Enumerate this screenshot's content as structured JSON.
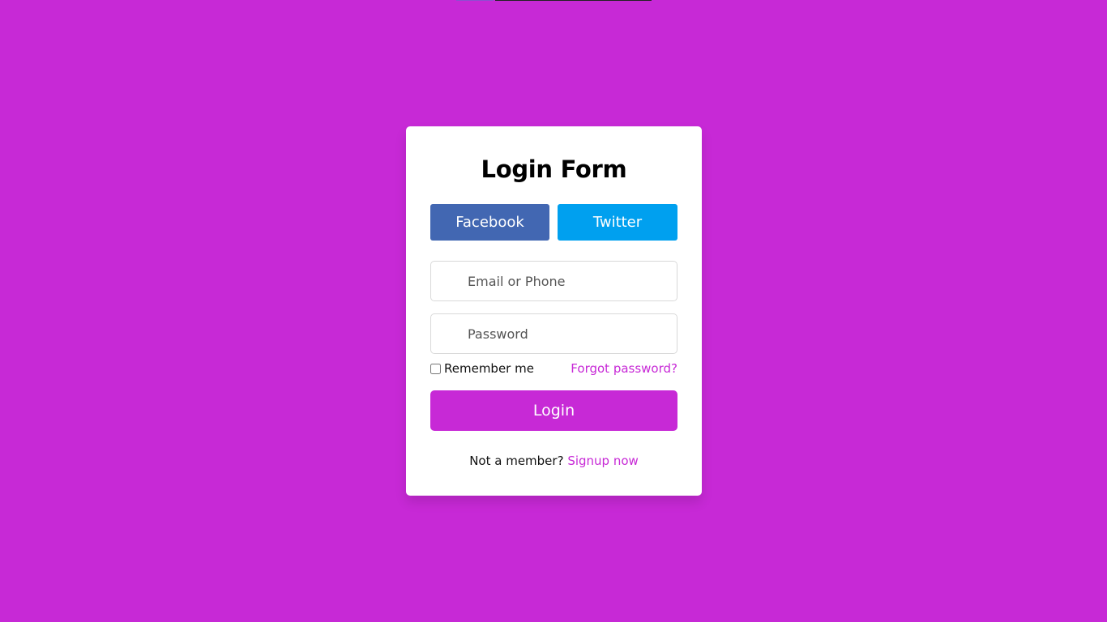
{
  "colors": {
    "background": "#c729d6",
    "accent": "#c729d6",
    "facebook": "#4267b2",
    "twitter": "#00a0ef"
  },
  "form": {
    "title": "Login Form",
    "facebook_label": "Facebook",
    "twitter_label": "Twitter",
    "email_placeholder": "Email or Phone",
    "email_value": "",
    "password_placeholder": "Password",
    "password_value": "",
    "remember_label": "Remember me",
    "remember_checked": false,
    "forgot_label": "Forgot password?",
    "login_label": "Login",
    "signup_prompt": "Not a member?",
    "signup_link": "Signup now"
  }
}
